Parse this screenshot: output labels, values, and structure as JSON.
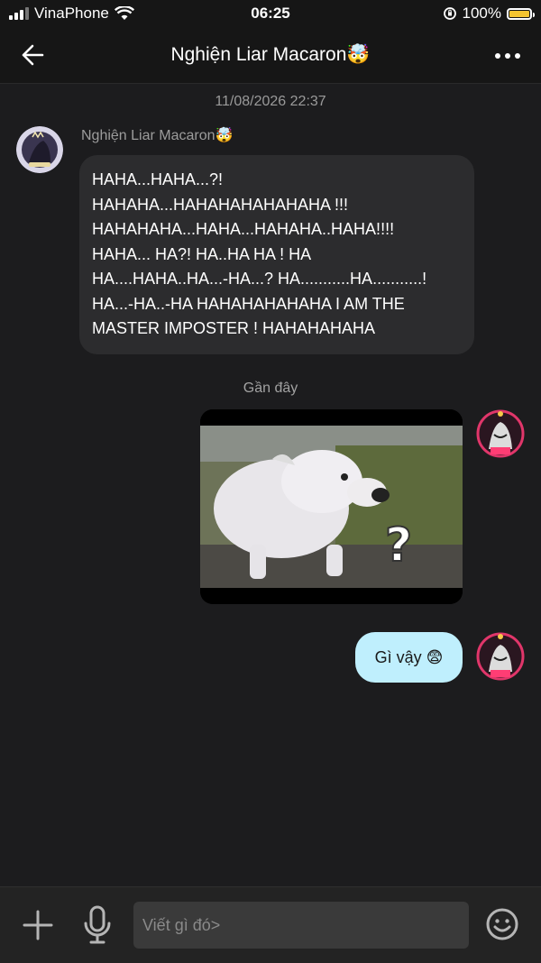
{
  "status_bar": {
    "carrier": "VinaPhone",
    "time": "06:25",
    "battery_percent": "100%",
    "battery_color": "#f4c430"
  },
  "header": {
    "title": "Nghiện Liar Macaron🤯",
    "back_icon": "arrow-left-icon",
    "more_icon": "more-horizontal-icon"
  },
  "conversation": {
    "timestamp": "11/08/2026 22:37",
    "section_label": "Gần đây",
    "messages": [
      {
        "direction": "incoming",
        "sender": "Nghiện Liar Macaron🤯",
        "text": "HAHA...HAHA...?!\nHAHAHA...HAHAHAHAHAHAHA !!!\nHAHAHAHA...HAHA...HAHAHA..HAHA!!!!\nHAHA... HA?! HA..HA HA ! HA\nHA....HAHA..HA...-HA...? HA...........HA...........!\nHA...-HA..-HA HAHAHAHAHAHA I AM THE\nMASTER IMPOSTER ! HAHAHAHAHA"
      },
      {
        "direction": "outgoing",
        "type": "image",
        "image_content": "white-dog-question-mark-meme"
      },
      {
        "direction": "outgoing",
        "text": "Gì vậy 😨"
      }
    ],
    "outgoing_bubble_color": "#bfeffd"
  },
  "composer": {
    "placeholder": "Viết gì đó>",
    "value": "",
    "icons": [
      "plus-icon",
      "microphone-icon",
      "emoji-icon"
    ]
  }
}
